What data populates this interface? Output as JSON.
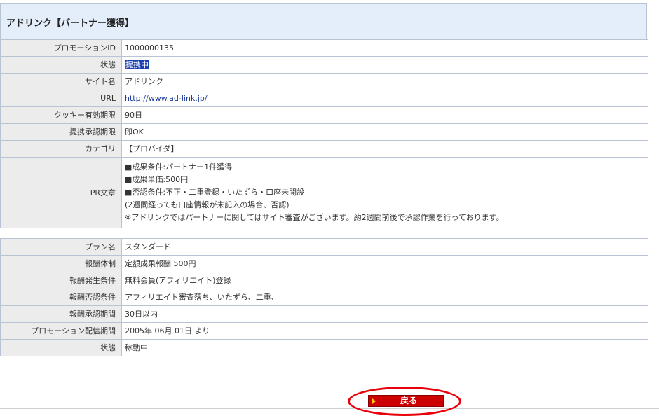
{
  "header": {
    "title": "アドリンク【パートナー獲得】"
  },
  "promotion": {
    "rows": [
      {
        "label": "プロモーションID",
        "value": "1000000135"
      },
      {
        "label": "状態",
        "value": "提携中"
      },
      {
        "label": "サイト名",
        "value": "アドリンク"
      },
      {
        "label": "URL",
        "value": "http://www.ad-link.jp/"
      },
      {
        "label": "クッキー有効期限",
        "value": "90日"
      },
      {
        "label": "提携承認期限",
        "value": "即OK"
      },
      {
        "label": "カテゴリ",
        "value": "【プロバイダ】"
      }
    ],
    "pr_label": "PR文章",
    "pr_lines": [
      "■成果条件:パートナー1件獲得",
      "■成果単価:500円",
      "■否認条件:不正・二重登録・いたずら・口座未開設",
      "(2週間経っても口座情報が未記入の場合、否認)",
      "※アドリンクではパートナーに関してはサイト審査がございます。約2週間前後で承認作業を行っております。"
    ]
  },
  "plan": {
    "rows": [
      {
        "label": "プラン名",
        "value": "スタンダード"
      },
      {
        "label": "報酬体制",
        "value": "定額成果報酬 500円"
      },
      {
        "label": "報酬発生条件",
        "value": "無料会員(アフィリエイト)登録"
      },
      {
        "label": "報酬否認条件",
        "value": "アフィリエイト審査落ち、いたずら、二重、"
      },
      {
        "label": "報酬承認期間",
        "value": "30日以内"
      },
      {
        "label": "プロモーション配信期間",
        "value": "2005年 06月 01日 より"
      },
      {
        "label": "状態",
        "value": "稼動中"
      }
    ]
  },
  "actions": {
    "back_label": "戻る"
  },
  "colors": {
    "header_bg": "#e4eefb",
    "label_bg": "#ececec",
    "highlight": "#1a3fb5",
    "button": "#cc0000",
    "annotation": "#e8000a"
  }
}
